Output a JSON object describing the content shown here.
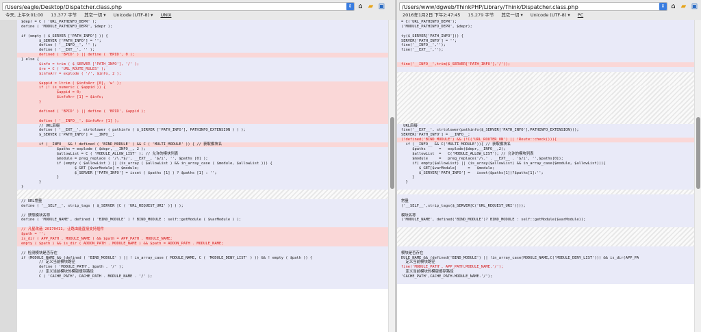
{
  "colors": {
    "same_bg": "#e9eaf8",
    "del_bg": "#fad7d7",
    "gap_bg": "#e8e8e8",
    "changed_text": "#d61a1a"
  },
  "left": {
    "path": "/Users/eagle/Desktop/Dispatcher.class.php",
    "toolbar_icons": [
      "dropdown-arrow-icon",
      "home-icon",
      "open-folder-icon",
      "save-icon"
    ],
    "status": {
      "date": "今天, 上午9:01:00",
      "size": "13,377 字节",
      "filter": "其它一切 ▾",
      "encoding": "Unicode (UTF-8) ▾",
      "eol": "UNIX"
    },
    "lines": [
      {
        "k": "same",
        "t": "$depr = C ( 'URL_PATHINFO_DEPR' );"
      },
      {
        "k": "same",
        "t": "define ( 'MODULE_PATHINFO_DEPR', $depr );"
      },
      {
        "k": "same",
        "t": ""
      },
      {
        "k": "same",
        "t": "if (empty ( $_SERVER ['PATH_INFO'] )) {"
      },
      {
        "k": "same",
        "t": "        $_SERVER ['PATH_INFO'] = '';"
      },
      {
        "k": "same",
        "t": "        define ( '__INFO__', '' );"
      },
      {
        "k": "same",
        "t": "        define ( '__EXT__', '' );"
      },
      {
        "k": "del",
        "t": "        defined ( 'BPID' ) || define ( 'BPID', 0 );",
        "r": true
      },
      {
        "k": "same",
        "t": "} else {"
      },
      {
        "k": "same",
        "t": "        $info = trim ( $_SERVER ['PATH_INFO'], '/' );",
        "r": true
      },
      {
        "k": "same",
        "t": "        $re = C ( 'URL_ROUTE_RULES' );",
        "r": true
      },
      {
        "k": "same",
        "t": "        $infoArr = explode ( '/', $info, 2 );",
        "r": true
      },
      {
        "k": "same",
        "t": ""
      },
      {
        "k": "del",
        "t": "        $appid = ltrim ( $infoArr [0], 'w' );",
        "r": true
      },
      {
        "k": "del",
        "t": "        if (! is_numeric ( $appid )) {",
        "r": true
      },
      {
        "k": "del",
        "t": "                $appid = 0;",
        "r": true
      },
      {
        "k": "del",
        "t": "                $infoArr [1] = $info;",
        "r": true
      },
      {
        "k": "del",
        "t": "        }",
        "r": true
      },
      {
        "k": "del",
        "t": ""
      },
      {
        "k": "del",
        "t": "        defined ( 'BPID' ) || define ( 'BPID', $appid );",
        "r": true
      },
      {
        "k": "del",
        "t": ""
      },
      {
        "k": "del",
        "t": "        define ( '__INFO__', $infoArr [1] );",
        "r": true
      },
      {
        "k": "same",
        "t": "        // URL后缀"
      },
      {
        "k": "same",
        "t": "        define ( '__EXT__', strtolower ( pathinfo ( $_SERVER ['PATH_INFO'], PATHINFO_EXTENSION ) ) );"
      },
      {
        "k": "same",
        "t": "        $_SERVER ['PATH_INFO'] = __INFO__;"
      },
      {
        "k": "same",
        "t": ""
      },
      {
        "k": "del",
        "t": "        if (__INFO__ && ! defined ( 'BIND_MODULE' ) && C ( 'MULTI_MODULE' )) { // 获取模块名"
      },
      {
        "k": "same",
        "t": "                $paths = explode ( $depr, __INFO__, 2 );"
      },
      {
        "k": "same",
        "t": "                $allowList = C ( 'MODULE_ALLOW_LIST' ); // 允许的模块列表"
      },
      {
        "k": "same",
        "t": "                $module = preg_replace ( '/\\.*$/', __EXT__, '$/i', '', $paths [0] );"
      },
      {
        "k": "same",
        "t": "                if (empty ( $allowList ) || (is_array ( $allowList ) && in_array_case ( $module, $allowList ))) {"
      },
      {
        "k": "same",
        "t": "                        $_GET [$varModule] = $module;"
      },
      {
        "k": "same",
        "t": "                        $_SERVER ['PATH_INFO'] = isset ( $paths [1] ) ? $paths [1] : '';"
      },
      {
        "k": "same",
        "t": "                }"
      },
      {
        "k": "same",
        "t": "        }"
      },
      {
        "k": "same",
        "t": "}"
      },
      {
        "k": "gap",
        "t": ""
      },
      {
        "k": "gap",
        "t": ""
      },
      {
        "k": "same",
        "t": "// URL常量"
      },
      {
        "k": "same",
        "t": "define ( '__SELF__', strip_tags ( $_SERVER [C ( 'URL_REQUEST_URI' )] ) );"
      },
      {
        "k": "same",
        "t": ""
      },
      {
        "k": "same",
        "t": "// 获取模块名称"
      },
      {
        "k": "same",
        "t": "define ( 'MODULE_NAME', defined ( 'BIND_MODULE' ) ? BIND_MODULE : self::getModule ( $varModule ) );"
      },
      {
        "k": "same",
        "t": ""
      },
      {
        "k": "del",
        "t": "// 凡星改造 20170411, 让路由能直接支持插件",
        "r": true
      },
      {
        "k": "del",
        "t": "$path = '';",
        "r": true
      },
      {
        "k": "del",
        "t": "is_dir ( APP_PATH . MODULE_NAME ) && $path = APP_PATH . MODULE_NAME;",
        "r": true
      },
      {
        "k": "del",
        "t": "empty ( $path ) && is_dir ( ADDON_PATH . MODULE_NAME ) && $path = ADDON_PATH . MODULE_NAME;",
        "r": true
      },
      {
        "k": "same",
        "t": ""
      },
      {
        "k": "same",
        "t": "// 检测模块是否存在"
      },
      {
        "k": "same",
        "t": "if (MODULE_NAME && (defined ( 'BIND_MODULE' ) || ! in_array_case ( MODULE_NAME, C ( 'MODULE_DENY_LIST' ) )) && ! empty ( $path )) {"
      },
      {
        "k": "same",
        "t": "        // 定义当前模块路径"
      },
      {
        "k": "same",
        "t": "        define ( 'MODULE_PATH', $path . '/' );"
      },
      {
        "k": "same",
        "t": "        // 定义当前模块的模版缓存路径"
      },
      {
        "k": "same",
        "t": "        C ( 'CACHE_PATH', CACHE_PATH . MODULE_NAME . '/' );"
      },
      {
        "k": "same",
        "t": ""
      },
      {
        "k": "same",
        "t": ""
      }
    ]
  },
  "right": {
    "path": "/Users/www/dgweb/ThinkPHP/Library/Think/Dispatcher.class.php",
    "toolbar_icons": [
      "dropdown-arrow-icon",
      "home-icon",
      "open-folder-icon",
      "save-icon"
    ],
    "status": {
      "date": "2016年1月2日 下午2:47:45",
      "size": "15,279 字节",
      "filter": "其它一切 ▾",
      "encoding": "Unicode (UTF-8) ▾",
      "eol": "PC"
    },
    "lines": [
      {
        "k": "same",
        "t": "= C('URL_PATHINFO_DEPR');"
      },
      {
        "k": "same",
        "t": "('MODULE_PATHINFO_DEPR', $depr);"
      },
      {
        "k": "same",
        "t": ""
      },
      {
        "k": "same",
        "t": "ty($_SERVER['PATH_INFO'])) {"
      },
      {
        "k": "same",
        "t": "SERVER['PATH_INFO'] = '';"
      },
      {
        "k": "same",
        "t": "fine('__INFO__','');"
      },
      {
        "k": "same",
        "t": "fine('__EXT__','');"
      },
      {
        "k": "same",
        "t": ""
      },
      {
        "k": "same",
        "t": ""
      },
      {
        "k": "del",
        "t": "fine('__INFO__',trim($_SERVER['PATH_INFO'],'/'));",
        "r": true
      },
      {
        "k": "same",
        "t": ""
      },
      {
        "k": "gap",
        "t": ""
      },
      {
        "k": "gap",
        "t": ""
      },
      {
        "k": "gap",
        "t": ""
      },
      {
        "k": "gap",
        "t": ""
      },
      {
        "k": "gap",
        "t": ""
      },
      {
        "k": "gap",
        "t": ""
      },
      {
        "k": "gap",
        "t": ""
      },
      {
        "k": "gap",
        "t": ""
      },
      {
        "k": "gap",
        "t": ""
      },
      {
        "k": "gap",
        "t": ""
      },
      {
        "k": "gap",
        "t": ""
      },
      {
        "k": "same",
        "t": " URL后缀"
      },
      {
        "k": "same",
        "t": "fine('__EXT__', strtolower(pathinfo($_SERVER['PATH_INFO'],PATHINFO_EXTENSION)));"
      },
      {
        "k": "same",
        "t": "SERVER['PATH_INFO'] = __INFO__;"
      },
      {
        "k": "del",
        "t": "(!defined('BIND_MODULE') && (!C('URL_ROUTER_ON') || !Route::check())){",
        "r": true
      },
      {
        "k": "same",
        "t": "  if (__INFO__ && C('MULTI_MODULE')){ // 获取模块名"
      },
      {
        "k": "same",
        "t": "     $paths      =   explode($depr,__INFO__,2);"
      },
      {
        "k": "same",
        "t": "     $allowList  =   C('MODULE_ALLOW_LIST'); // 允许的模块列表"
      },
      {
        "k": "same",
        "t": "     $module     =   preg_replace('/\\.' . __EXT__ . '$/i', '',$paths[0]);"
      },
      {
        "k": "same",
        "t": "     if( empty($allowList) || (is_array($allowList) && in_array_case($module, $allowList))){"
      },
      {
        "k": "same",
        "t": "        $_GET[$varModule]     =   $module;"
      },
      {
        "k": "same",
        "t": "        $_SERVER['PATH_INFO'] =   isset($paths[1])?$paths[1]:'';"
      },
      {
        "k": "same",
        "t": "     }"
      },
      {
        "k": "same",
        "t": "  }"
      },
      {
        "k": "same",
        "t": ""
      },
      {
        "k": "gap",
        "t": ""
      },
      {
        "k": "same",
        "t": ""
      },
      {
        "k": "same",
        "t": "常量"
      },
      {
        "k": "same",
        "t": "('__SELF__',strip_tags($_SERVER[C('URL_REQUEST_URI')]));"
      },
      {
        "k": "same",
        "t": ""
      },
      {
        "k": "same",
        "t": "模块名称"
      },
      {
        "k": "same",
        "t": "('MODULE_NAME', defined('BIND_MODULE')? BIND_MODULE : self::getModule($varModule));"
      },
      {
        "k": "same",
        "t": ""
      },
      {
        "k": "gap",
        "t": ""
      },
      {
        "k": "gap",
        "t": ""
      },
      {
        "k": "gap",
        "t": ""
      },
      {
        "k": "gap",
        "t": ""
      },
      {
        "k": "same",
        "t": ""
      },
      {
        "k": "same",
        "t": "模块是否存在"
      },
      {
        "k": "same",
        "t": "DULE_NAME && (defined('BIND_MODULE') || !in_array_case(MODULE_NAME,C('MODULE_DENY_LIST'))) && is_dir(APP_PA"
      },
      {
        "k": "same",
        "t": "  定义当前模块路径"
      },
      {
        "k": "same",
        "t": "fine('MODULE_PATH', APP_PATH.MODULE_NAME.'/');",
        "r": true
      },
      {
        "k": "same",
        "t": "  定义当前模块的模版缓存路径"
      },
      {
        "k": "same",
        "t": "'CACHE_PATH',CACHE_PATH.MODULE_NAME.'/');"
      },
      {
        "k": "same",
        "t": ""
      }
    ]
  }
}
